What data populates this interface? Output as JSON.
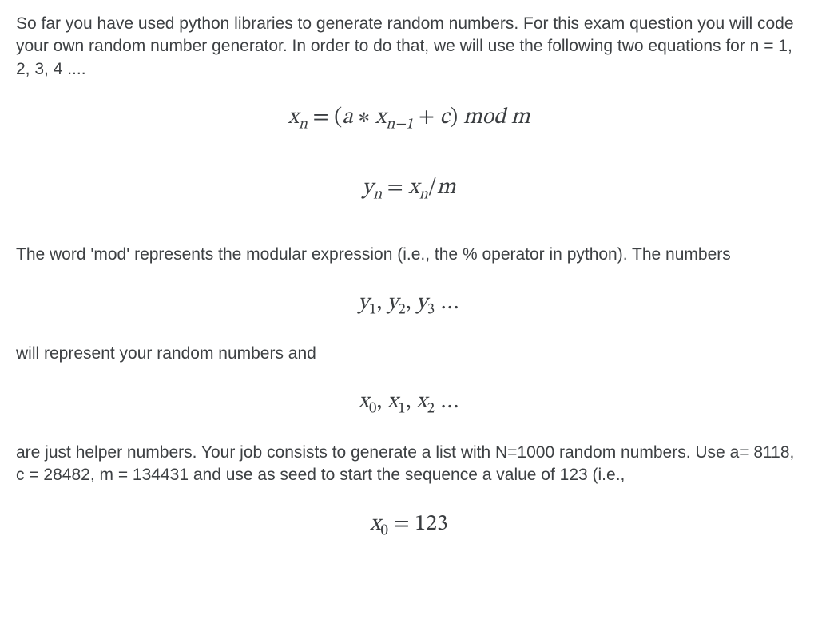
{
  "paragraphs": {
    "p1": "So far you have used python libraries to generate random numbers. For this exam question you will code your own random number generator. In order to do that, we will use the following two equations for n = 1, 2, 3, 4 ....",
    "p2": "The word 'mod' represents the modular expression (i.e., the % operator in python). The numbers",
    "p3": "will represent your random numbers and",
    "p4": " are just helper numbers. Your job consists to generate a list with N=1000 random numbers. Use a= 8118, c = 28482, m = 134431 and use as seed to start the sequence a value of 123 (i.e.,"
  },
  "equations": {
    "eq1_var": "x",
    "eq1_sub1": "n",
    "eq1_eq": " = ",
    "eq1_lpar": "(",
    "eq1_a": "a",
    "eq1_ast": " ∗ ",
    "eq1_x2": "x",
    "eq1_sub2": "n−1",
    "eq1_plus": " + ",
    "eq1_c": "c",
    "eq1_rpar": ")",
    "eq1_mod": "  mod  ",
    "eq1_m": "m",
    "eq2_y": "y",
    "eq2_subn": "n",
    "eq2_eq": " = ",
    "eq2_x": "x",
    "eq2_subn2": "n",
    "eq2_slash": "/",
    "eq2_m": "m",
    "eq3_y1": "y",
    "eq3_s1": "1",
    "eq3_c1": ", ",
    "eq3_y2": "y",
    "eq3_s2": "2",
    "eq3_c2": ", ",
    "eq3_y3": "y",
    "eq3_s3": "3",
    "eq3_dots": " …",
    "eq4_x0": "x",
    "eq4_s0": "0",
    "eq4_c1": ", ",
    "eq4_x1": "x",
    "eq4_s1": "1",
    "eq4_c2": ", ",
    "eq4_x2": "x",
    "eq4_s2": "2",
    "eq4_dots": " …",
    "eq5_x": "x",
    "eq5_s0": "0",
    "eq5_eq": " = ",
    "eq5_val": "123"
  }
}
